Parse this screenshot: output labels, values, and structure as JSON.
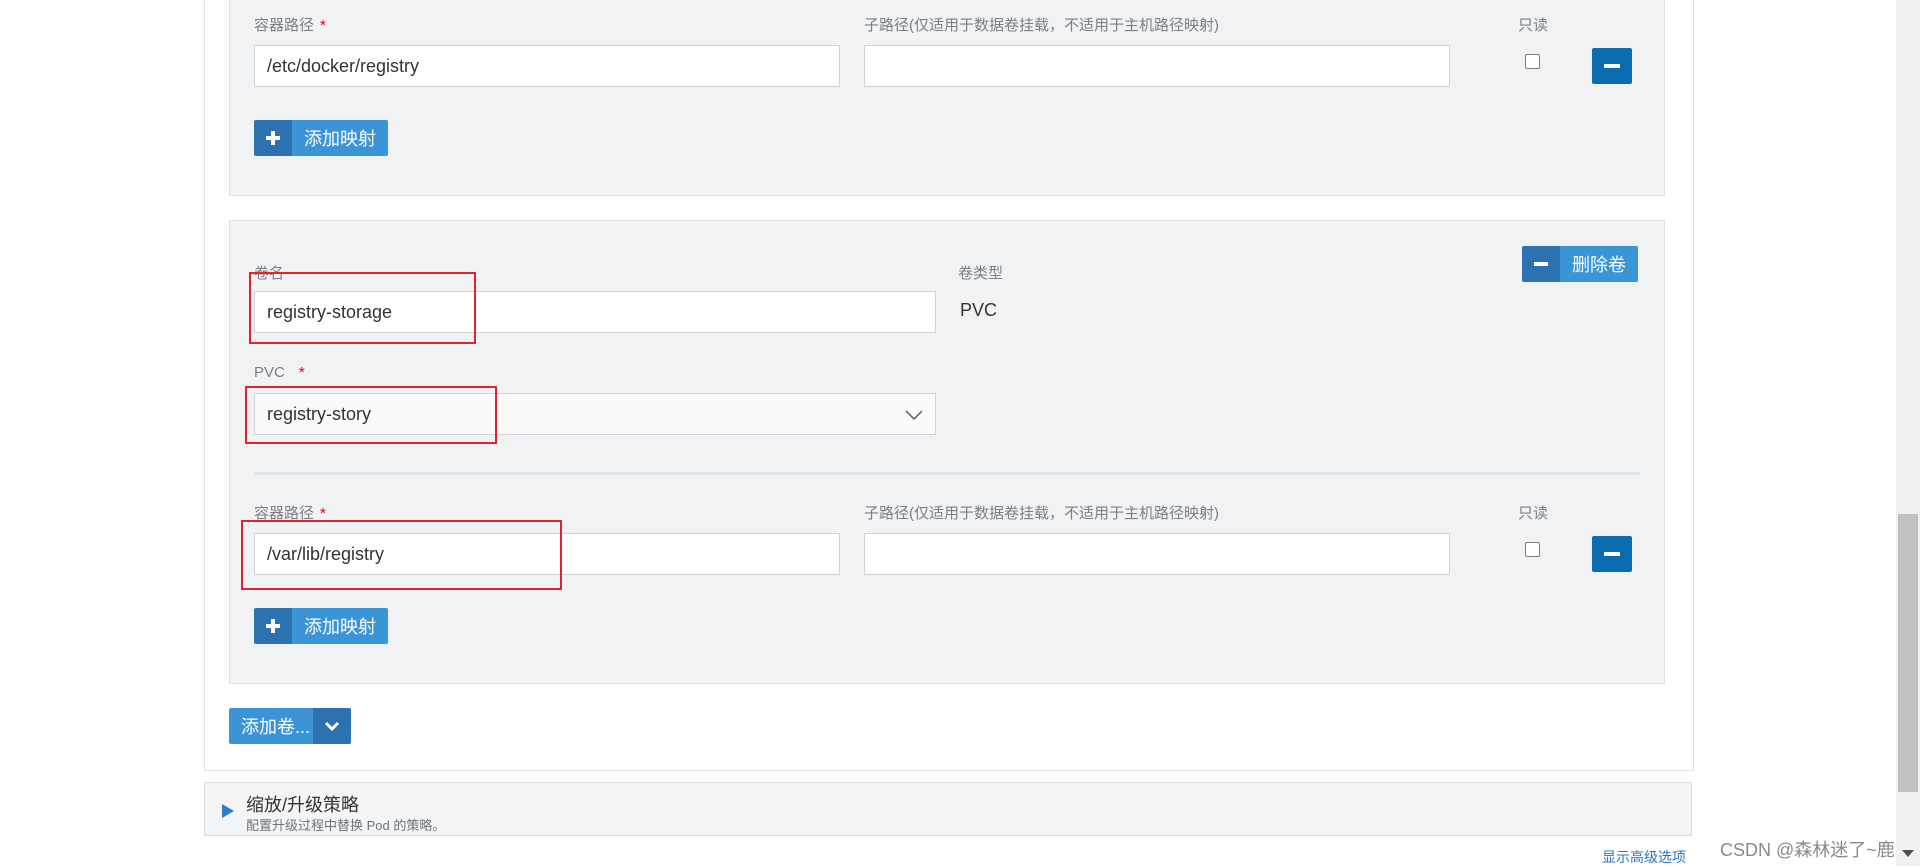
{
  "mapping1": {
    "container_path_label": "容器路径",
    "container_path_value": "/etc/docker/registry",
    "subpath_label": "子路径(仅适用于数据卷挂载，不适用于主机路径映射)",
    "subpath_value": "",
    "readonly_label": "只读",
    "add_mapping_label": "添加映射"
  },
  "volume": {
    "name_label": "卷名",
    "name_value": "registry-storage",
    "type_label": "卷类型",
    "type_value": "PVC",
    "pvc_label": "PVC",
    "pvc_value": "registry-story",
    "delete_label": "删除卷",
    "container_path_label": "容器路径",
    "container_path_value": "/var/lib/registry",
    "subpath_label": "子路径(仅适用于数据卷挂载，不适用于主机路径映射)",
    "subpath_value": "",
    "readonly_label": "只读",
    "add_mapping_label": "添加映射"
  },
  "add_volume_label": "添加卷...",
  "scaling": {
    "title": "缩放/升级策略",
    "description": "配置升级过程中替换 Pod 的策略。"
  },
  "advanced_link": "显示高级选项",
  "watermark": "CSDN @森林迷了~鹿",
  "required_mark": "*",
  "colors": {
    "primary": "#3a94d6",
    "primary_dark": "#0b6cb0",
    "highlight": "#e0242b",
    "panel_bg": "#f1f2f4"
  }
}
